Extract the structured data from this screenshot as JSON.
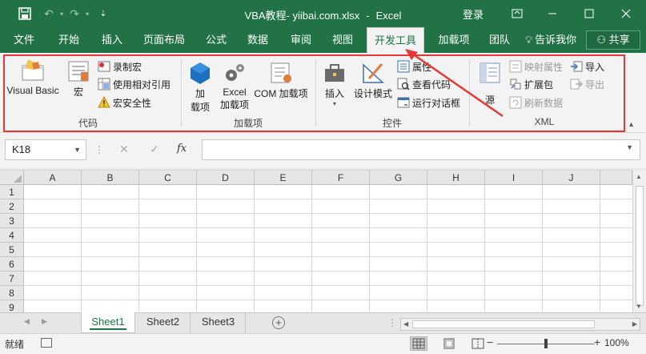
{
  "titlebar": {
    "title_doc": "VBA教程- yiibai.com.xlsx",
    "title_sep": "-",
    "title_app": "Excel",
    "login": "登录",
    "bg": "#217346"
  },
  "tabs": [
    {
      "label": "文件"
    },
    {
      "label": "开始"
    },
    {
      "label": "插入"
    },
    {
      "label": "页面布局"
    },
    {
      "label": "公式"
    },
    {
      "label": "数据"
    },
    {
      "label": "审阅"
    },
    {
      "label": "视图"
    },
    {
      "label": "开发工具",
      "active": true
    },
    {
      "label": "加载项"
    },
    {
      "label": "团队"
    }
  ],
  "tellme": "告诉我你",
  "share": "共享",
  "ribbon": {
    "code": {
      "label": "代码",
      "visual_basic": "Visual Basic",
      "macros": "宏",
      "record_macro": "录制宏",
      "relative_ref": "使用相对引用",
      "macro_security": "宏安全性"
    },
    "addins": {
      "label": "加载项",
      "addins_1": "加",
      "addins_2": "载项",
      "excel_addins_1": "Excel",
      "excel_addins_2": "加载项",
      "com_addins": "COM 加载项"
    },
    "controls": {
      "label": "控件",
      "insert": "插入",
      "design_mode": "设计模式",
      "properties": "属性",
      "view_code": "查看代码",
      "run_dialog": "运行对话框"
    },
    "xml": {
      "label": "XML",
      "source": "源",
      "map_properties": "映射属性",
      "expansion_packs": "扩展包",
      "refresh_data": "刷新数据",
      "import": "导入",
      "export": "导出"
    }
  },
  "formula_bar": {
    "name_box": "K18",
    "fx": "fx",
    "value": ""
  },
  "grid": {
    "columns": [
      "A",
      "B",
      "C",
      "D",
      "E",
      "F",
      "G",
      "H",
      "I",
      "J"
    ],
    "rows": [
      "1",
      "2",
      "3",
      "4",
      "5",
      "6",
      "7",
      "8",
      "9"
    ]
  },
  "sheets": [
    {
      "label": "Sheet1",
      "active": true
    },
    {
      "label": "Sheet2"
    },
    {
      "label": "Sheet3"
    }
  ],
  "status": {
    "ready": "就绪",
    "zoom": "100%"
  },
  "colors": {
    "accent": "#217346",
    "highlight": "#e53935"
  }
}
